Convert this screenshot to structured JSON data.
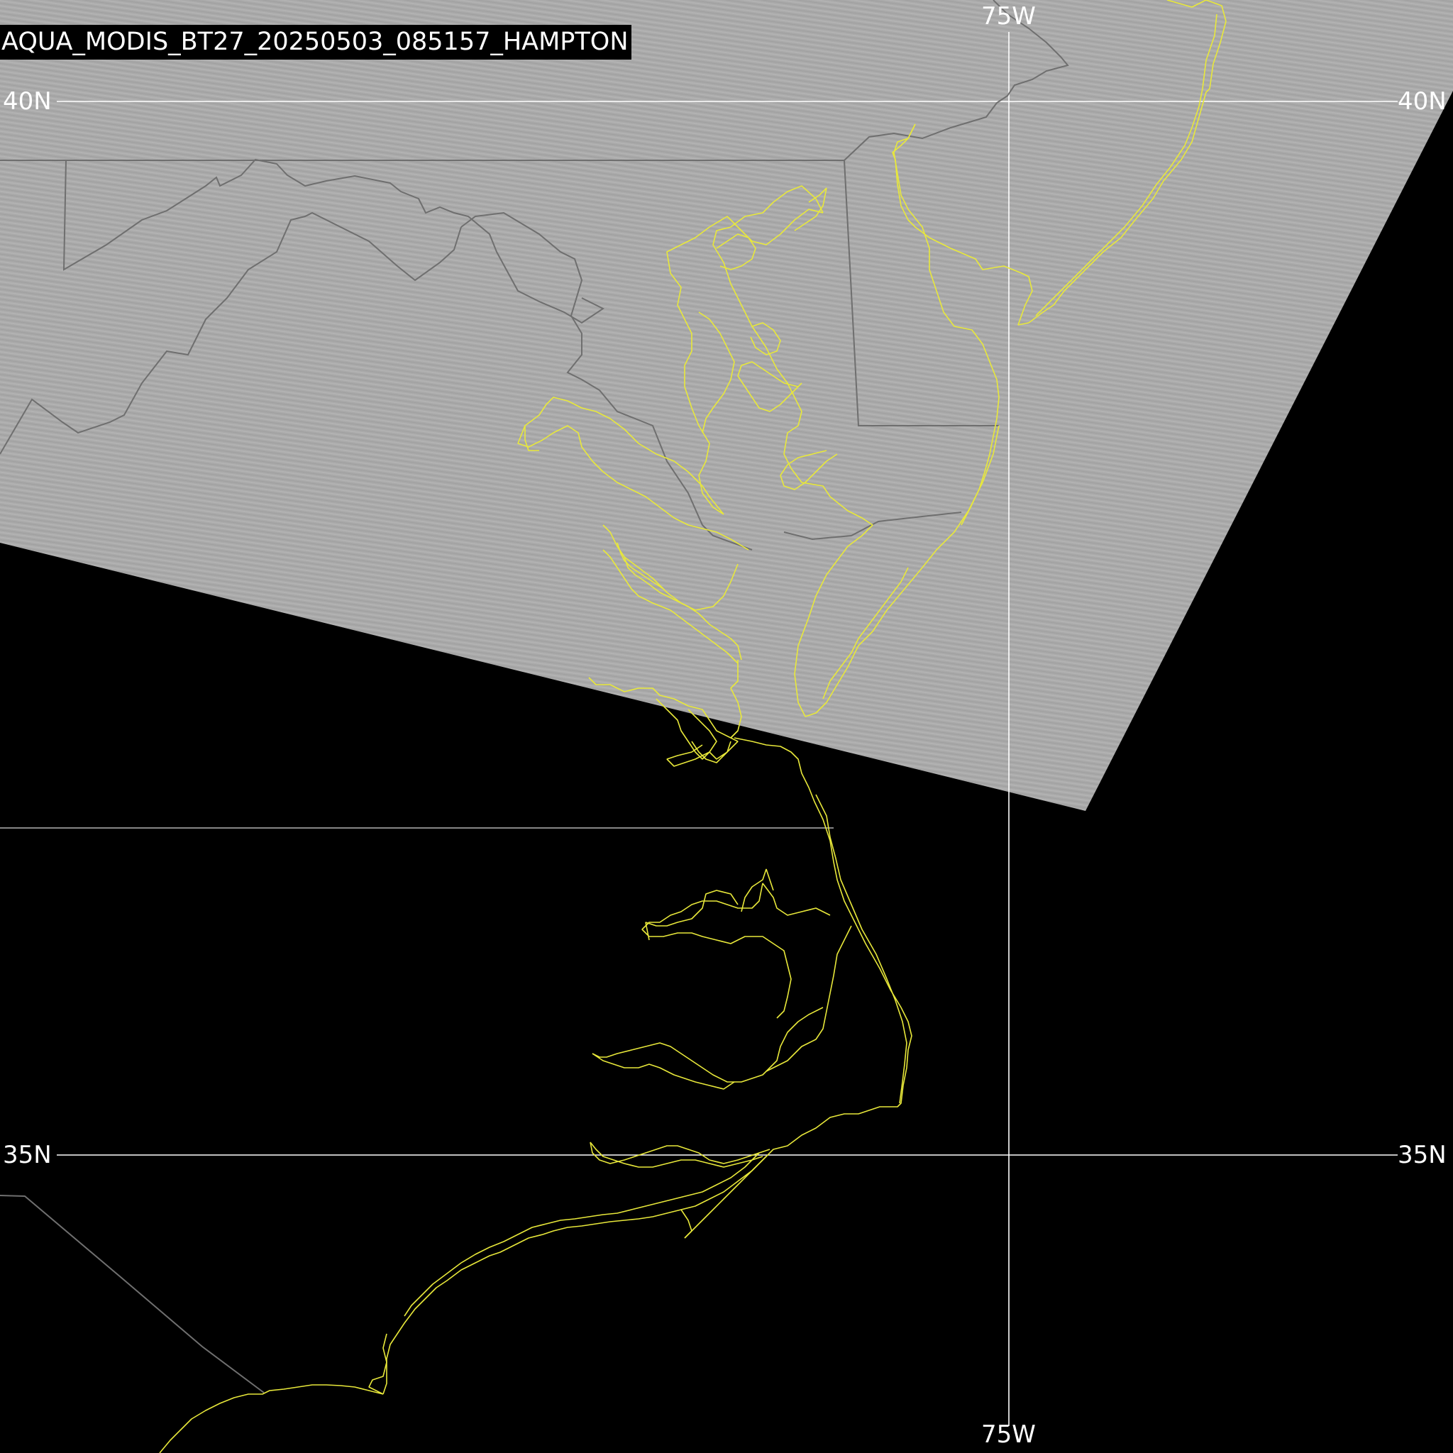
{
  "image_title": "AQUA_MODIS_BT27_20250503_085157_HAMPTON",
  "grid_labels": {
    "lon_top": "75W",
    "lon_bottom": "75W",
    "lat_40_left": "40N",
    "lat_40_right": "40N",
    "lat_35_left": "35N",
    "lat_35_right": "35N"
  },
  "colors": {
    "background": "#000000",
    "swath_gray": "#a9a9a9",
    "coastline": "#ffff33",
    "gridline": "#ffffff",
    "state_border": "#7a7a7a"
  }
}
